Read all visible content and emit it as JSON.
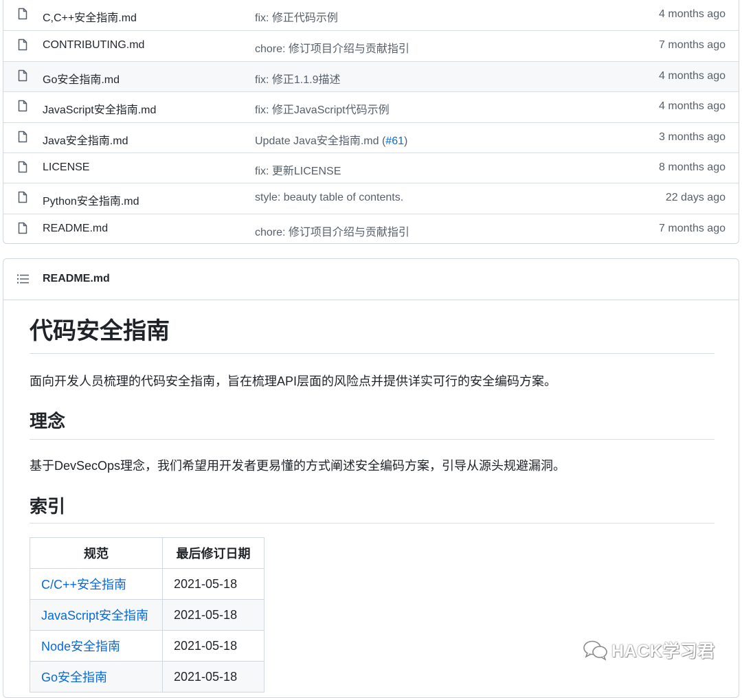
{
  "files": [
    {
      "name": "C,C++安全指南.md",
      "commit": "fix: 修正代码示例",
      "pr": "",
      "commit_suffix": "",
      "age": "4 months ago"
    },
    {
      "name": "CONTRIBUTING.md",
      "commit": "chore: 修订项目介绍与贡献指引",
      "pr": "",
      "commit_suffix": "",
      "age": "7 months ago"
    },
    {
      "name": "Go安全指南.md",
      "commit": "fix: 修正1.1.9描述",
      "pr": "",
      "commit_suffix": "",
      "age": "4 months ago"
    },
    {
      "name": "JavaScript安全指南.md",
      "commit": "fix: 修正JavaScript代码示例",
      "pr": "",
      "commit_suffix": "",
      "age": "4 months ago"
    },
    {
      "name": "Java安全指南.md",
      "commit": "Update Java安全指南.md (",
      "pr": "#61",
      "commit_suffix": ")",
      "age": "3 months ago"
    },
    {
      "name": "LICENSE",
      "commit": "fix: 更新LICENSE",
      "pr": "",
      "commit_suffix": "",
      "age": "8 months ago"
    },
    {
      "name": "Python安全指南.md",
      "commit": "style: beauty table of contents.",
      "pr": "",
      "commit_suffix": "",
      "age": "22 days ago"
    },
    {
      "name": "README.md",
      "commit": "chore: 修订项目介绍与贡献指引",
      "pr": "",
      "commit_suffix": "",
      "age": "7 months ago"
    }
  ],
  "readme": {
    "header": "README.md",
    "title": "代码安全指南",
    "intro": "面向开发人员梳理的代码安全指南，旨在梳理API层面的风险点并提供详实可行的安全编码方案。",
    "h_concept": "理念",
    "concept": "基于DevSecOps理念，我们希望用开发者更易懂的方式阐述安全编码方案，引导从源头规避漏洞。",
    "h_index": "索引",
    "table": {
      "headers": [
        "规范",
        "最后修订日期"
      ],
      "rows": [
        {
          "name": "C/C++安全指南",
          "date": "2021-05-18"
        },
        {
          "name": "JavaScript安全指南",
          "date": "2021-05-18"
        },
        {
          "name": "Node安全指南",
          "date": "2021-05-18"
        },
        {
          "name": "Go安全指南",
          "date": "2021-05-18"
        }
      ]
    }
  },
  "watermark": "HACK学习君",
  "colors": {
    "link": "#0969da",
    "muted": "#57606a",
    "border": "#d0d7de"
  }
}
